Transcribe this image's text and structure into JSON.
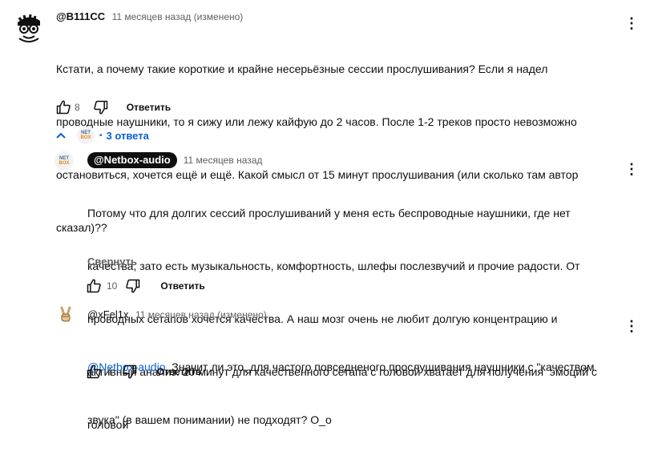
{
  "comment1": {
    "handle": "@B111CC",
    "meta": "11 месяцев назад (изменено)",
    "lines": [
      "Кстати, а почему такие короткие и крайне несерьёзные сессии прослушивания? Если я надел",
      "проводные наушники, то я сижу или лежу кайфую до 2 часов. После 1-2 треков просто невозможно",
      "остановиться, хочется ещё и ещё. Какой смысл от 15 минут прослушивания (или сколько там автор",
      "сказал)??"
    ],
    "likes": "8",
    "reply_label": "Ответить"
  },
  "replies_toggle": {
    "label": "3 ответа"
  },
  "netbox_avatar": {
    "top": "NET",
    "bottom": "BOX"
  },
  "reply1": {
    "handle": "@Netbox-audio",
    "meta": "11 месяцев назад",
    "lines": [
      "Потому что для долгих сессий прослушиваний у меня есть беспроводные наушники, где нет",
      "качества, зато есть музыкальность, комфортность, шлефы послезвучий и прочие радости. От",
      "проводных сетапов хочется качества. А наш мозг очень не любит долгую концентрацию и",
      "активный анализ. 20 минут для качественного сетапа с головой хватает для получения  эмоций с",
      "головой"
    ],
    "collapse_label": "Свернуть",
    "likes": "10",
    "reply_label": "Ответить"
  },
  "reply2": {
    "handle": "@xFel1x",
    "meta": "11 месяцев назад (изменено)",
    "mention": "@Netbox-audio",
    "line1_rest": "  Значит ли это, для частого повседненого прослушивания наушники с \"качеством",
    "line2": "звука\" (в вашем понимании) не подходят? О_о",
    "likes": "4",
    "reply_label": "Ответить"
  },
  "icons": [
    "avatar",
    "like-icon",
    "dislike-icon",
    "more-vert-icon",
    "chevron-up-icon"
  ],
  "colors": {
    "link": "#065fd4",
    "meta": "#606060",
    "text": "#0f0f0f",
    "chip": "#0f0f0f"
  }
}
